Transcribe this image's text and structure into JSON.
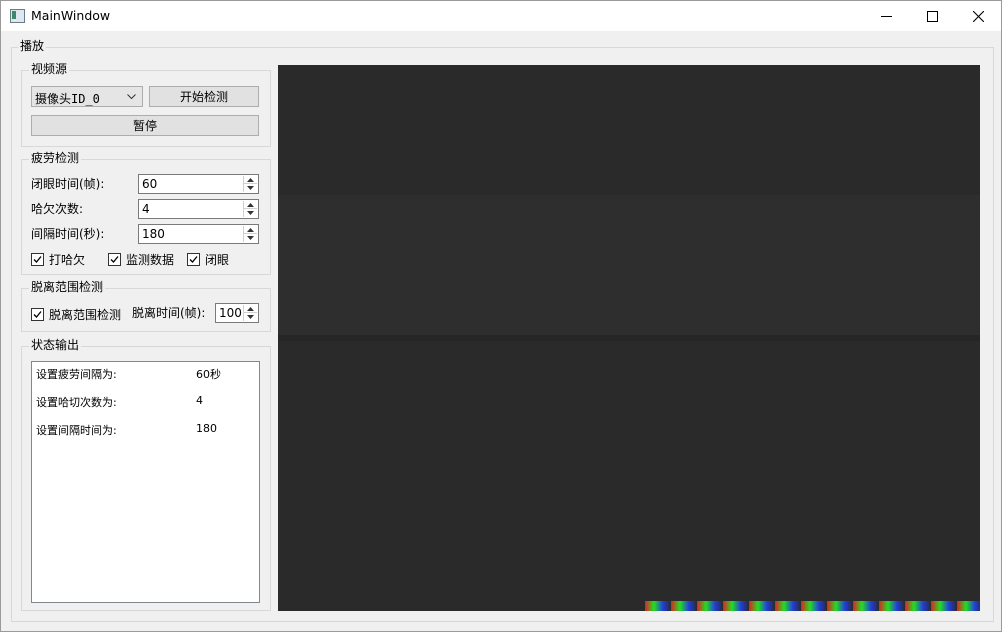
{
  "window": {
    "title": "MainWindow"
  },
  "playback_group": {
    "title": "播放"
  },
  "video_source": {
    "title": "视频源",
    "camera_select": "摄像头ID_0",
    "start_detect_label": "开始检测",
    "pause_label": "暂停"
  },
  "fatigue": {
    "title": "疲劳检测",
    "eye_close_label": "闭眼时间(帧):",
    "eye_close_value": "60",
    "yawn_label": "哈欠次数:",
    "yawn_value": "4",
    "interval_label": "间隔时间(秒):",
    "interval_value": "180",
    "checks": [
      {
        "label": "打哈欠",
        "checked": true
      },
      {
        "label": "监测数据",
        "checked": true
      },
      {
        "label": "闭眼",
        "checked": true
      }
    ]
  },
  "away": {
    "title": "脱离范围检测",
    "check_label": "脱离范围检测",
    "checked": true,
    "time_label": "脱离时间(帧):",
    "time_value": "100"
  },
  "status": {
    "title": "状态输出",
    "lines": [
      {
        "key": "设置疲劳间隔为:",
        "value": "60秒"
      },
      {
        "key": "设置哈切次数为:",
        "value": "4"
      },
      {
        "key": "设置间隔时间为:",
        "value": "180"
      }
    ]
  },
  "colors": {
    "video_bg": "#2a2a2a",
    "window_bg": "#f0f0f0"
  }
}
